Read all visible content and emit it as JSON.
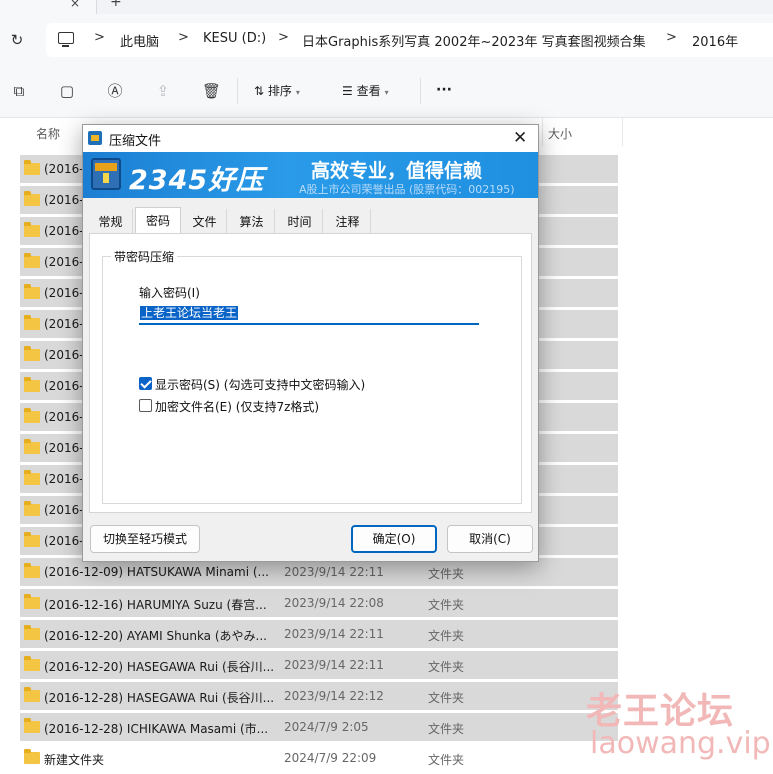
{
  "tabstrip": {
    "close_glyph": "×",
    "new_glyph": "+"
  },
  "address": {
    "icons": [
      "refresh-icon",
      "computer-icon"
    ],
    "crumbs": [
      "此电脑",
      "KESU (D:)",
      "日本Graphis系列写真 2002年~2023年 写真套图视频合集",
      "2016年"
    ],
    "separator": ">"
  },
  "toolbar": {
    "icons": [
      "copy-icon",
      "paste-icon",
      "rename-icon",
      "share-icon",
      "delete-icon"
    ],
    "sort_label": "排序",
    "view_label": "查看",
    "more_label": "···"
  },
  "columns": {
    "name": "名称",
    "size": "大小"
  },
  "files": [
    {
      "name": "(2016-",
      "date": "",
      "type": ""
    },
    {
      "name": "(2016-",
      "date": "",
      "type": ""
    },
    {
      "name": "(2016-",
      "date": "",
      "type": ""
    },
    {
      "name": "(2016-",
      "date": "",
      "type": ""
    },
    {
      "name": "(2016-",
      "date": "",
      "type": ""
    },
    {
      "name": "(2016-",
      "date": "",
      "type": ""
    },
    {
      "name": "(2016-",
      "date": "",
      "type": ""
    },
    {
      "name": "(2016-",
      "date": "",
      "type": ""
    },
    {
      "name": "(2016-",
      "date": "",
      "type": ""
    },
    {
      "name": "(2016-",
      "date": "",
      "type": ""
    },
    {
      "name": "(2016-",
      "date": "",
      "type": ""
    },
    {
      "name": "(2016-",
      "date": "",
      "type": ""
    },
    {
      "name": "(2016-",
      "date": "",
      "type": ""
    },
    {
      "name": "(2016-12-09) HATSUKAWA Minami (...",
      "date": "2023/9/14 22:11",
      "type": "文件夹"
    },
    {
      "name": "(2016-12-16) HARUMIYA Suzu (春宫...",
      "date": "2023/9/14 22:08",
      "type": "文件夹"
    },
    {
      "name": "(2016-12-20) AYAMI Shunka (あやみ...",
      "date": "2023/9/14 22:11",
      "type": "文件夹"
    },
    {
      "name": "(2016-12-20) HASEGAWA Rui (長谷川...",
      "date": "2023/9/14 22:11",
      "type": "文件夹"
    },
    {
      "name": "(2016-12-28) HASEGAWA Rui (長谷川...",
      "date": "2023/9/14 22:12",
      "type": "文件夹"
    },
    {
      "name": "(2016-12-28) ICHIKAWA Masami (市...",
      "date": "2024/7/9 2:05",
      "type": "文件夹"
    },
    {
      "name": "新建文件夹",
      "date": "2024/7/9 22:09",
      "type": "文件夹"
    }
  ],
  "dialog": {
    "title": "压缩文件",
    "close_glyph": "✕",
    "banner": {
      "logo": "2345好压",
      "slogan": "高效专业，值得信赖",
      "subtext": "A股上市公司荣誉出品 (股票代码：002195)"
    },
    "tabs": [
      "常规",
      "密码",
      "文件",
      "算法",
      "时间",
      "注释"
    ],
    "active_tab": "密码",
    "group_title": "带密码压缩",
    "password_label": "输入密码(I)",
    "password_value": "上老王论坛当老王",
    "show_password": {
      "label": "显示密码(S) (勾选可支持中文密码输入)",
      "checked": true
    },
    "encrypt_names": {
      "label": "加密文件名(E) (仅支持7z格式)",
      "checked": false
    },
    "mode_button": "切换至轻巧模式",
    "ok_button": "确定(O)",
    "cancel_button": "取消(C)"
  },
  "watermark": {
    "cn": "老王论坛",
    "en": "laowang.vip"
  },
  "colors": {
    "accent": "#0067c0",
    "banner": "#1f8fe0",
    "folder": "#f4c542",
    "watermark": "#f2b8b8"
  }
}
